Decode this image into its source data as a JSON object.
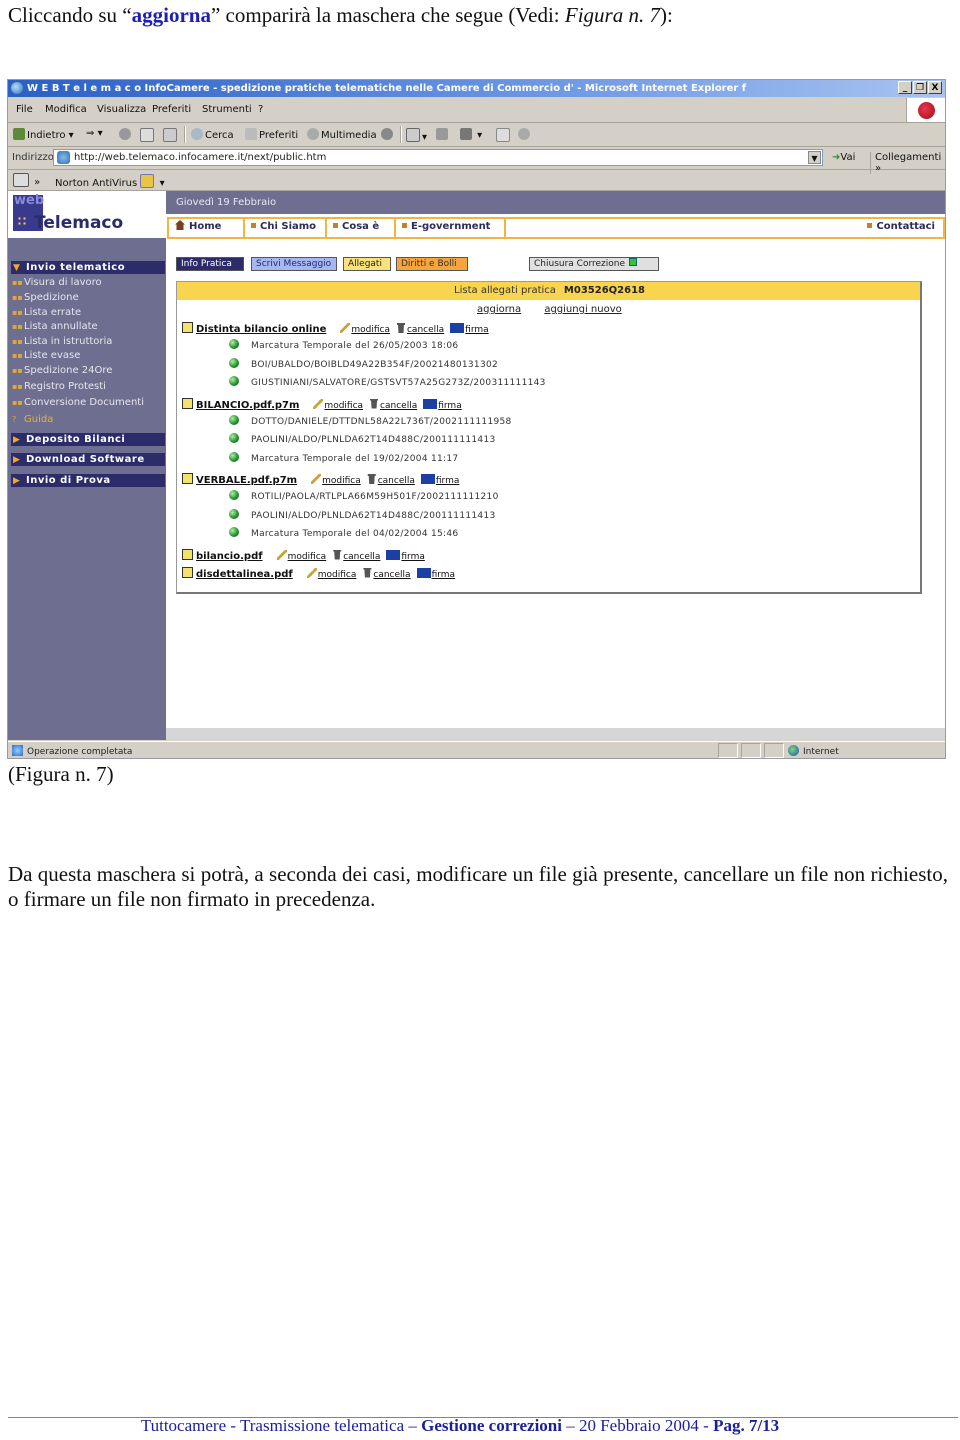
{
  "intro": {
    "prefix": "Cliccando su “",
    "highlight": "aggiorna",
    "middle": "” comparirà la maschera che segue (Vedi: ",
    "figure_ref": "Figura n. 7",
    "suffix": "):"
  },
  "browser": {
    "title": "W E B T e l e m a c o InfoCamere - spedizione pratiche telematiche nelle Camere di Commercio d' - Microsoft Internet Explorer f",
    "window_controls": [
      "_",
      "❐",
      "X"
    ],
    "menu": [
      "File",
      "Modifica",
      "Visualizza",
      "Preferiti",
      "Strumenti",
      "?"
    ],
    "toolbar": {
      "back": "Indietro",
      "search": "Cerca",
      "favorites": "Preferiti",
      "media": "Multimedia"
    },
    "address": {
      "label": "Indirizzo",
      "value": "http://web.telemaco.infocamere.it/next/public.htm",
      "go": "Vai",
      "links": "Collegamenti"
    },
    "norton": "Norton AntiVirus",
    "status": {
      "text": "Operazione completata",
      "zone": "Internet"
    }
  },
  "site": {
    "logo_web": "web",
    "logo_name": "Telemaco",
    "date": "Giovedì 19 Febbraio",
    "topnav": [
      "Home",
      "Chi Siamo",
      "Cosa è",
      "E-government",
      "Contattaci"
    ],
    "sidebar": {
      "section_open": "Invio telematico",
      "items": [
        "Visura di lavoro",
        "Spedizione",
        "Lista errate",
        "Lista annullate",
        "Lista in istruttoria",
        "Liste evase",
        "Spedizione 24Ore",
        "Registro Protesti",
        "Conversione Documenti"
      ],
      "guide": "Guida",
      "sections_closed": [
        "Deposito Bilanci",
        "Download Software",
        "Invio di Prova"
      ]
    },
    "tabs": {
      "info": "Info Pratica",
      "message": "Scrivi Messaggio",
      "attachments": "Allegati",
      "fees": "Diritti e Bolli",
      "close": "Chiusura Correzione"
    },
    "panel": {
      "title": "Lista allegati pratica",
      "practice_code": "M03526Q2618",
      "refresh": "aggiorna",
      "add_new": "aggiungi nuovo",
      "actions": {
        "edit": "modifica",
        "delete": "cancella",
        "sign": "firma"
      },
      "files": [
        {
          "name": "Distinta bilancio online",
          "signatures": [
            "Marcatura Temporale del 26/05/2003 18:06",
            "BOI/UBALDO/BOIBLD49A22B354F/20021480131302",
            "GIUSTINIANI/SALVATORE/GSTSVT57A25G273Z/200311111143"
          ]
        },
        {
          "name": "BILANCIO.pdf.p7m",
          "signatures": [
            "DOTTO/DANIELE/DTTDNL58A22L736T/2002111111958",
            "PAOLINI/ALDO/PLNLDA62T14D488C/200111111413",
            "Marcatura Temporale del 19/02/2004 11:17"
          ]
        },
        {
          "name": "VERBALE.pdf.p7m",
          "signatures": [
            "ROTILI/PAOLA/RTLPLA66M59H501F/2002111111210",
            "PAOLINI/ALDO/PLNLDA62T14D488C/200111111413",
            "Marcatura Temporale del 04/02/2004 15:46"
          ]
        },
        {
          "name": "bilancio.pdf",
          "signatures": []
        },
        {
          "name": "disdettalinea.pdf",
          "signatures": []
        }
      ]
    }
  },
  "caption": "(Figura n. 7)",
  "body_text": "Da questa maschera si potrà, a seconda dei casi, modificare un file già presente, cancellare un file non richiesto, o firmare un file non firmato in precedenza.",
  "footer": {
    "part1": "Tuttocamere - Trasmissione telematica – ",
    "bold1": "Gestione correzioni",
    "part2": " –  20 Febbraio 2004 - ",
    "bold2": "Pag. 7/13"
  }
}
